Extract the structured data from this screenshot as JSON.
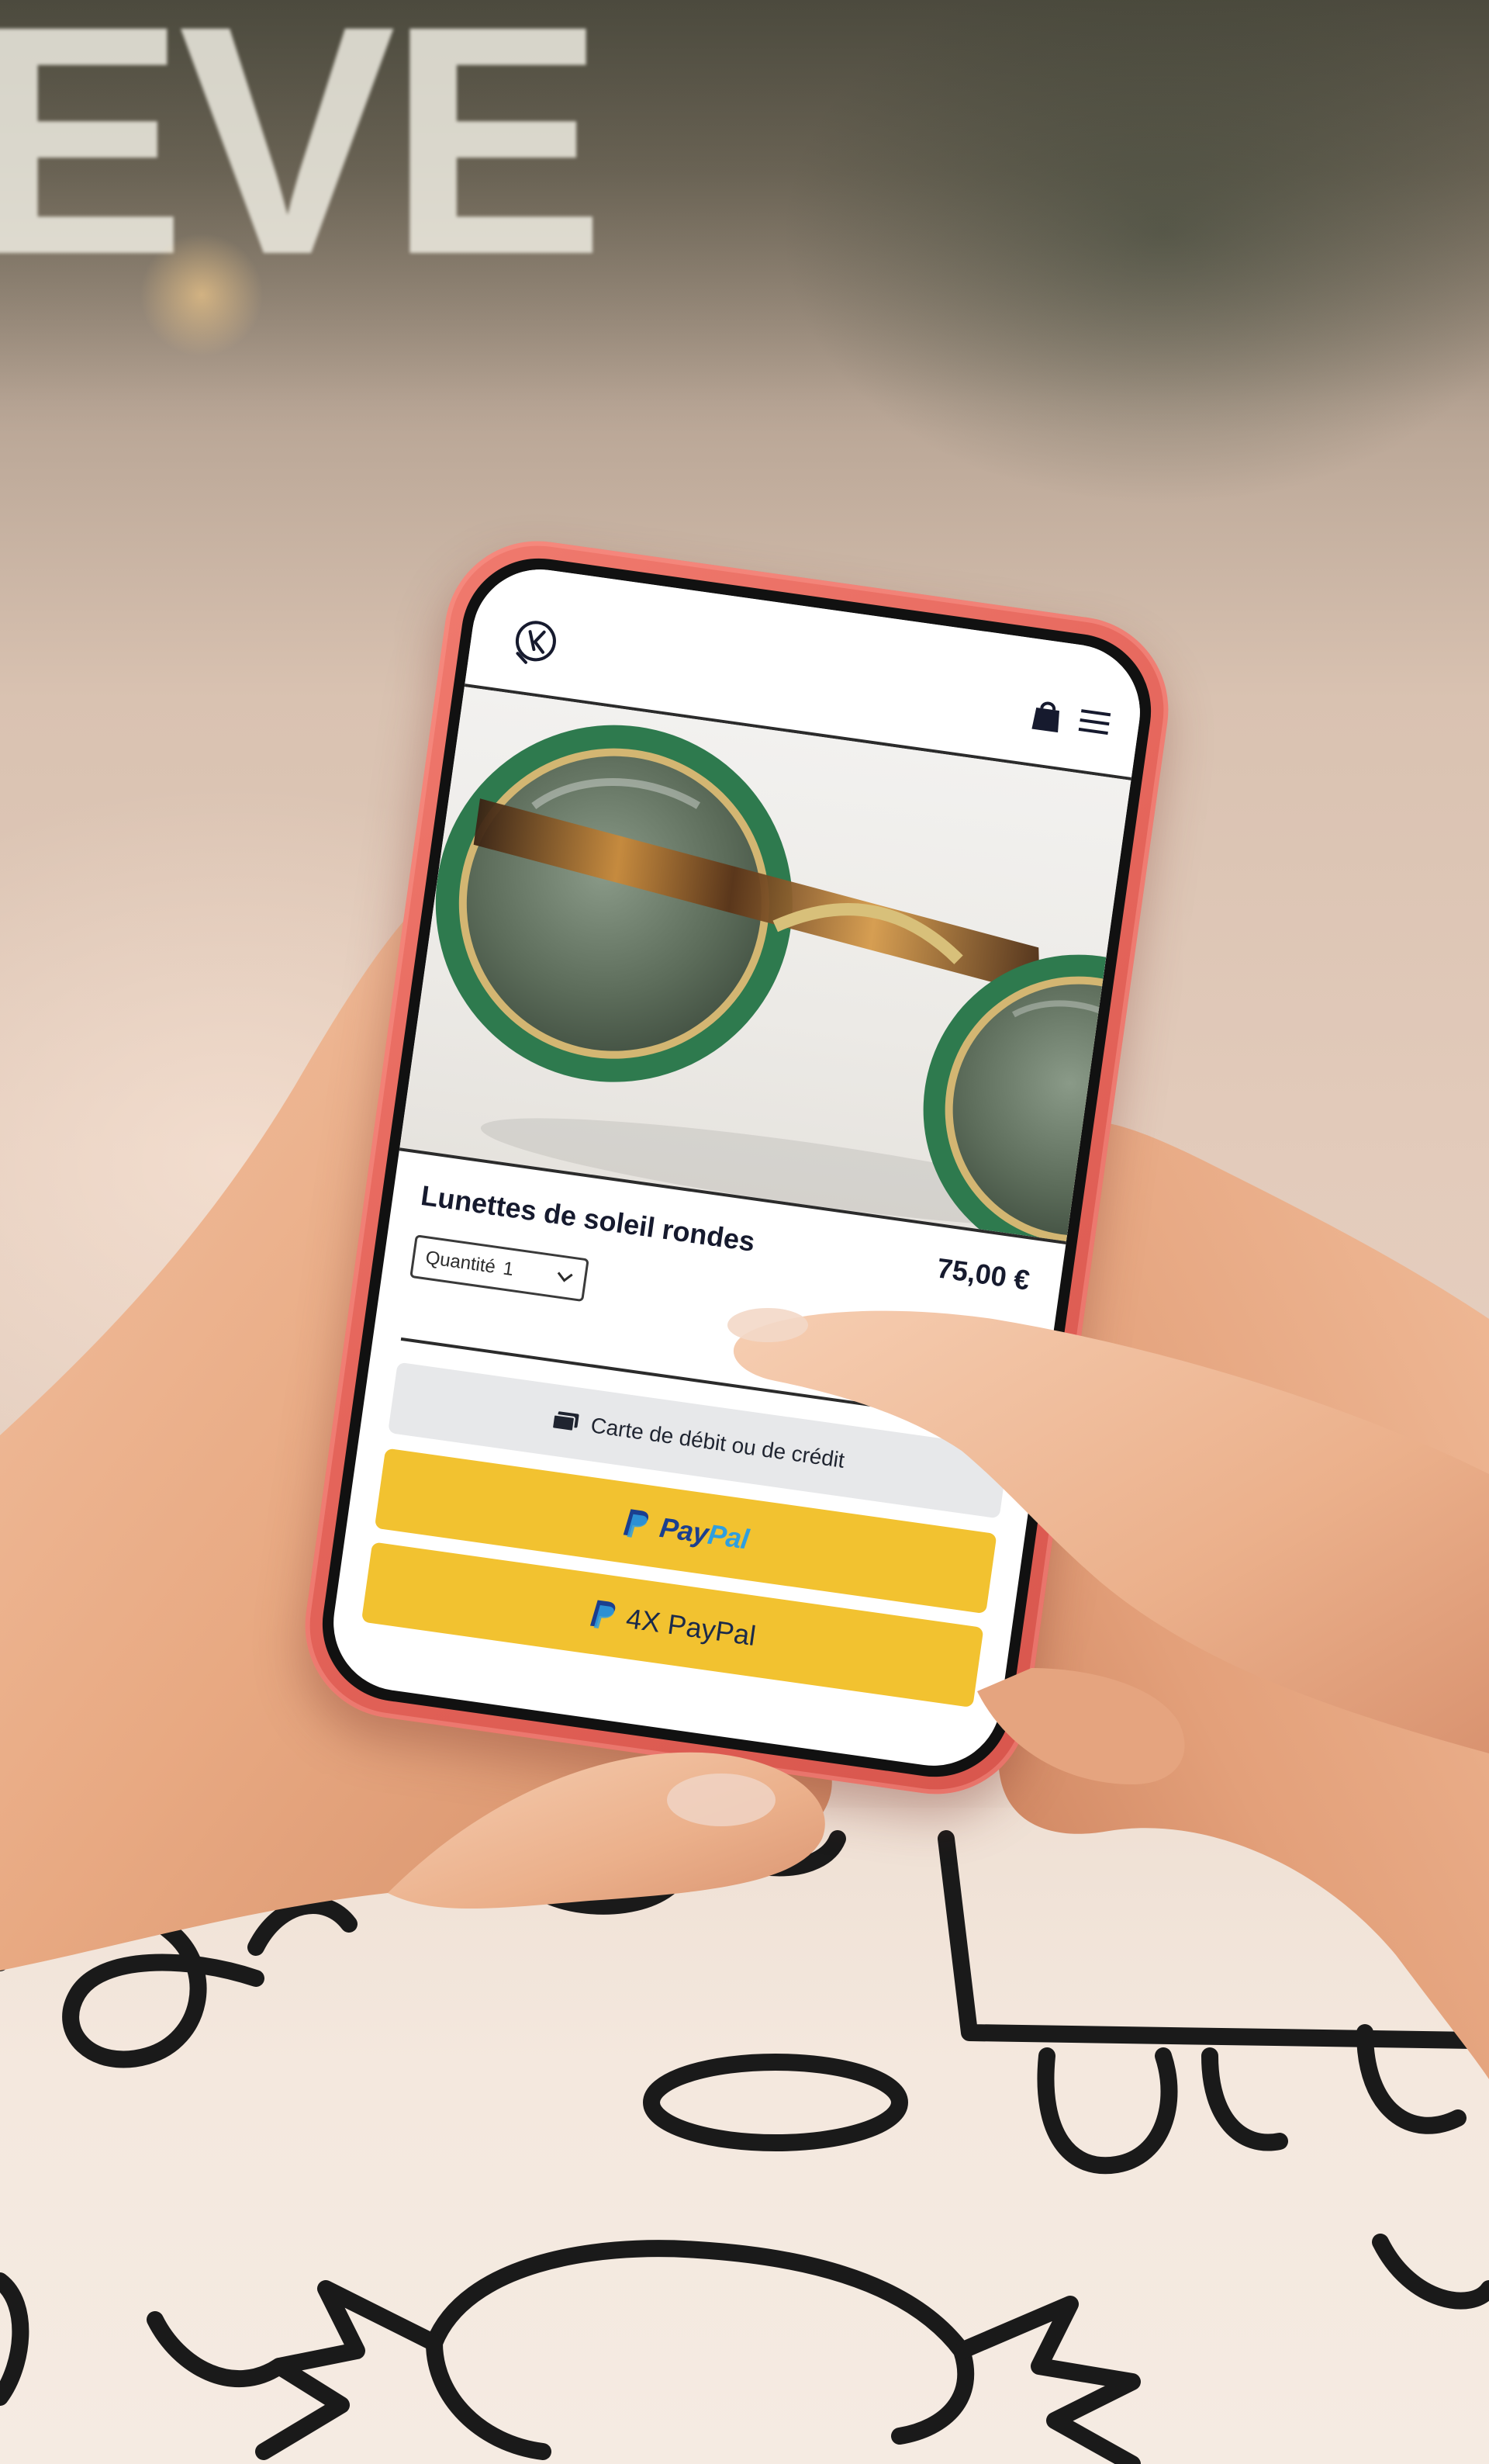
{
  "storefront_letters": "EVE",
  "app": {
    "logo_icon": "logo-icon",
    "cart_icon": "shopping-bag-icon",
    "menu_icon": "hamburger-menu-icon"
  },
  "product": {
    "title": "Lunettes de soleil rondes",
    "price": "75,00 €",
    "image_description_icon": "round-sunglasses-image"
  },
  "quantity": {
    "label": "Quantité",
    "value": "1"
  },
  "payment": {
    "card_label": "Carte de débit ou de crédit",
    "paypal_part1": "Pay",
    "paypal_part2": "Pal",
    "paypal_4x_label": "4X PayPal"
  },
  "colors": {
    "phone_case": "#e4645a",
    "paypal_button": "#f2c230",
    "paypal_dark_blue": "#1b3f8f",
    "paypal_light_blue": "#2f9fe0",
    "card_button": "#e7e8ea"
  }
}
